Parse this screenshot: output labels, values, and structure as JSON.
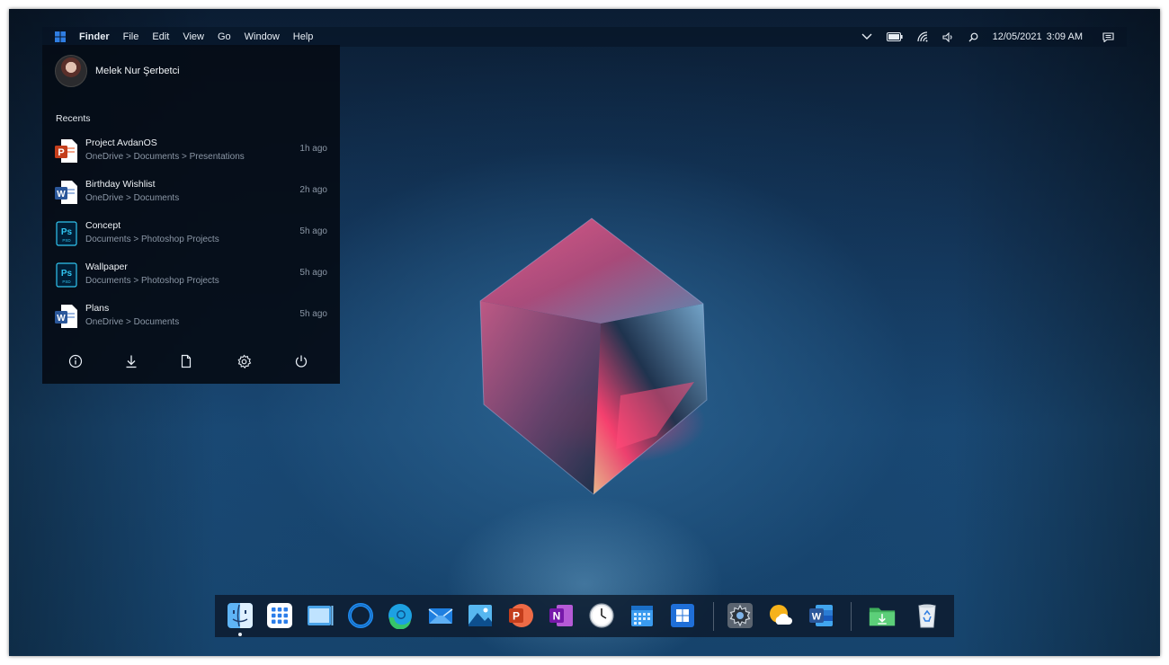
{
  "menubar": {
    "app_name": "Finder",
    "menus": [
      "File",
      "Edit",
      "View",
      "Go",
      "Window",
      "Help"
    ],
    "date": "12/05/2021",
    "time": "3:09 AM",
    "icons": [
      "windows-logo-icon",
      "chevron-down-icon",
      "battery-icon",
      "wifi-icon",
      "volume-icon",
      "search-icon",
      "notification-icon"
    ]
  },
  "start_panel": {
    "user_name": "Melek Nur Şerbetci",
    "recents_title": "Recents",
    "recents": [
      {
        "title": "Project AvdanOS",
        "path": "OneDrive > Documents > Presentations",
        "time": "1h ago",
        "icon": "powerpoint-file-icon"
      },
      {
        "title": "Birthday Wishlist",
        "path": "OneDrive > Documents",
        "time": "2h ago",
        "icon": "word-file-icon"
      },
      {
        "title": "Concept",
        "path": "Documents > Photoshop Projects",
        "time": "5h ago",
        "icon": "photoshop-file-icon"
      },
      {
        "title": "Wallpaper",
        "path": "Documents > Photoshop Projects",
        "time": "5h ago",
        "icon": "photoshop-file-icon"
      },
      {
        "title": "Plans",
        "path": "OneDrive > Documents",
        "time": "5h ago",
        "icon": "word-file-icon"
      }
    ],
    "ps_label": "Ps",
    "ps_sub": "PSD",
    "ppt_letter": "P",
    "word_letter": "W",
    "actions": [
      "info-icon",
      "download-icon",
      "document-icon",
      "settings-icon",
      "power-icon"
    ]
  },
  "dock": {
    "items": [
      "finder-icon",
      "launchpad-icon",
      "file-explorer-icon",
      "cortana-icon",
      "edge-icon",
      "mail-icon",
      "photos-icon",
      "powerpoint-icon",
      "onenote-icon",
      "clock-icon",
      "calendar-icon",
      "microsoft-store-icon",
      "settings-icon",
      "weather-icon",
      "word-icon",
      "downloads-icon",
      "recycle-bin-icon"
    ],
    "ppt_letter": "P",
    "onenote_letter": "N",
    "word_letter": "W"
  },
  "colors": {
    "accent_blue": "#2f7de1",
    "powerpoint": "#c43e1c",
    "word": "#2b579a",
    "photoshop": "#31c5f0",
    "onenote": "#7719aa"
  }
}
